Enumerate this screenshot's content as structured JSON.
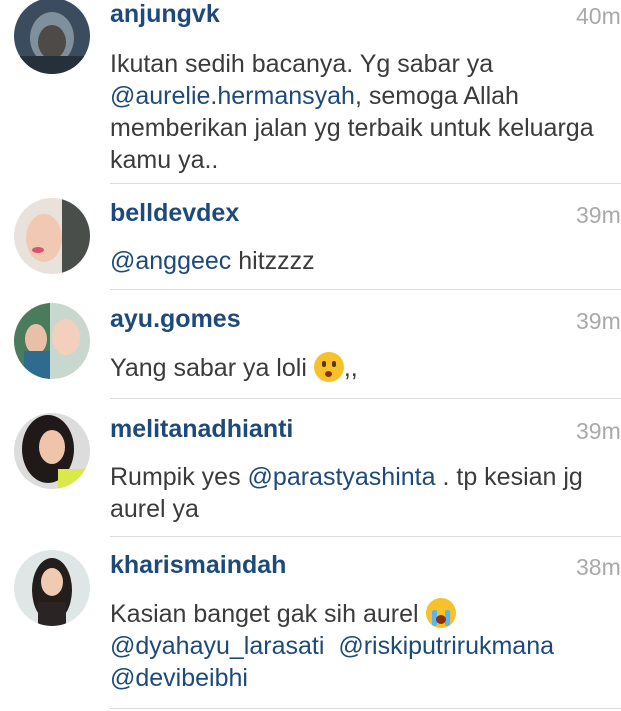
{
  "comments": [
    {
      "username": "anjungvk",
      "time": "40m",
      "text": [
        "Ikutan sedih bacanya. Yg sabar ya ",
        "@aurelie.hermansyah",
        ", semoga Allah memberikan jalan yg terbaik untuk keluarga kamu ya.."
      ]
    },
    {
      "username": "belldevdex",
      "time": "39m",
      "text": [
        "@anggeec",
        " hitzzzz"
      ]
    },
    {
      "username": "ayu.gomes",
      "time": "39m",
      "text": [
        "Yang sabar ya loli ",
        ",,"
      ],
      "emoji": "kissing-face-emoji"
    },
    {
      "username": "melitanadhianti",
      "time": "39m",
      "text": [
        "Rumpik yes ",
        "@parastyashinta",
        " . tp kesian jg aurel ya"
      ]
    },
    {
      "username": "kharismaindah",
      "time": "38m",
      "text": [
        "Kasian banget gak sih aurel ",
        "@dyahayu_larasati",
        "@riskiputrirukmana",
        "@devibeibhi"
      ],
      "emoji": "loudly-crying-face-emoji"
    }
  ],
  "colors": {
    "username": "#1d4a7a",
    "mention": "#1d4a7a",
    "body_text": "#3b3b3b",
    "timestamp": "#a9a9a9",
    "divider": "#dcdcdc"
  }
}
